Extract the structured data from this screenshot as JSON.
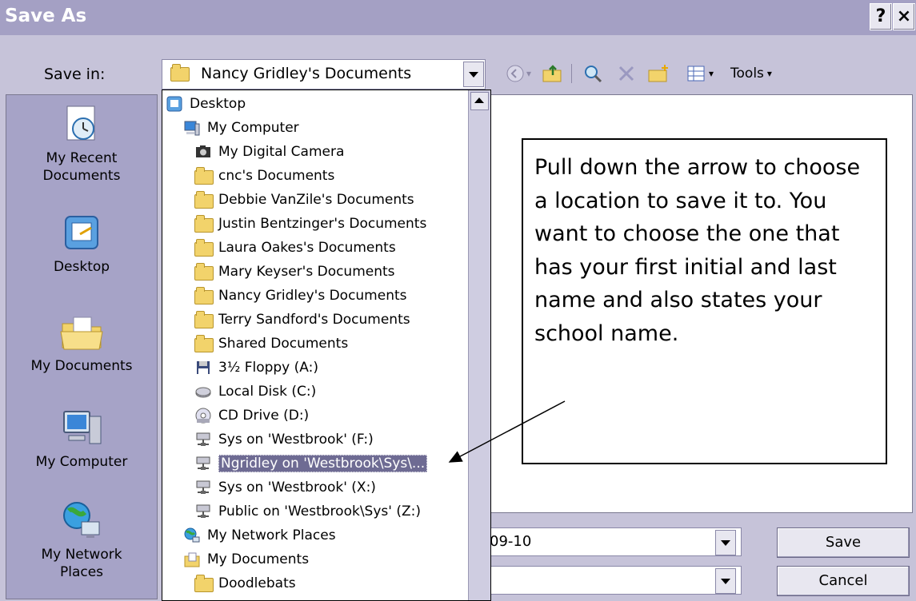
{
  "window": {
    "title": "Save As",
    "help_label": "?",
    "close_label": "×"
  },
  "save_in": {
    "label": "Save in:",
    "value": "Nancy Gridley's Documents"
  },
  "toolbar": {
    "tools_label": "Tools"
  },
  "places": [
    {
      "label_line1": "My Recent",
      "label_line2": "Documents",
      "icon": "recent-documents-icon"
    },
    {
      "label_line1": "Desktop",
      "label_line2": "",
      "icon": "desktop-icon"
    },
    {
      "label_line1": "My Documents",
      "label_line2": "",
      "icon": "my-documents-icon"
    },
    {
      "label_line1": "My Computer",
      "label_line2": "",
      "icon": "my-computer-icon"
    },
    {
      "label_line1": "My Network",
      "label_line2": "Places",
      "icon": "network-places-icon"
    }
  ],
  "dropdown": {
    "items": [
      {
        "label": "Desktop",
        "icon": "desktop-icon"
      },
      {
        "label": "My Computer",
        "icon": "computer-icon"
      },
      {
        "label": "My Digital Camera",
        "icon": "camera-icon"
      },
      {
        "label": "cnc's Documents",
        "icon": "folder-icon"
      },
      {
        "label": "Debbie VanZile's Documents",
        "icon": "folder-icon"
      },
      {
        "label": "Justin Bentzinger's Documents",
        "icon": "folder-icon"
      },
      {
        "label": "Laura Oakes's Documents",
        "icon": "folder-icon"
      },
      {
        "label": "Mary Keyser's Documents",
        "icon": "folder-icon"
      },
      {
        "label": "Nancy Gridley's Documents",
        "icon": "folder-icon"
      },
      {
        "label": "Terry Sandford's Documents",
        "icon": "folder-icon"
      },
      {
        "label": "Shared Documents",
        "icon": "folder-icon"
      },
      {
        "label": "3½ Floppy (A:)",
        "icon": "floppy-icon"
      },
      {
        "label": "Local Disk (C:)",
        "icon": "disk-icon"
      },
      {
        "label": "CD Drive (D:)",
        "icon": "cd-icon"
      },
      {
        "label": "Sys on 'Westbrook' (F:)",
        "icon": "network-drive-icon"
      },
      {
        "label": "Ngridley on 'Westbrook\\Sys\\...",
        "icon": "network-drive-icon",
        "selected": true
      },
      {
        "label": "Sys on 'Westbrook' (X:)",
        "icon": "network-drive-icon"
      },
      {
        "label": "Public on 'Westbrook\\Sys' (Z:)",
        "icon": "network-drive-icon"
      },
      {
        "label": "My Network Places",
        "icon": "network-places-icon"
      },
      {
        "label": "My Documents",
        "icon": "my-documents-icon"
      },
      {
        "label": "Doodlebats",
        "icon": "folder-icon"
      }
    ]
  },
  "file_name": {
    "value": "09-10"
  },
  "buttons": {
    "save_label": "Save",
    "cancel_label": "Cancel"
  },
  "callout": {
    "text": "Pull down the arrow to choose a location to save it to.  You want to choose the one that has your first initial and last name and also states your school name."
  }
}
